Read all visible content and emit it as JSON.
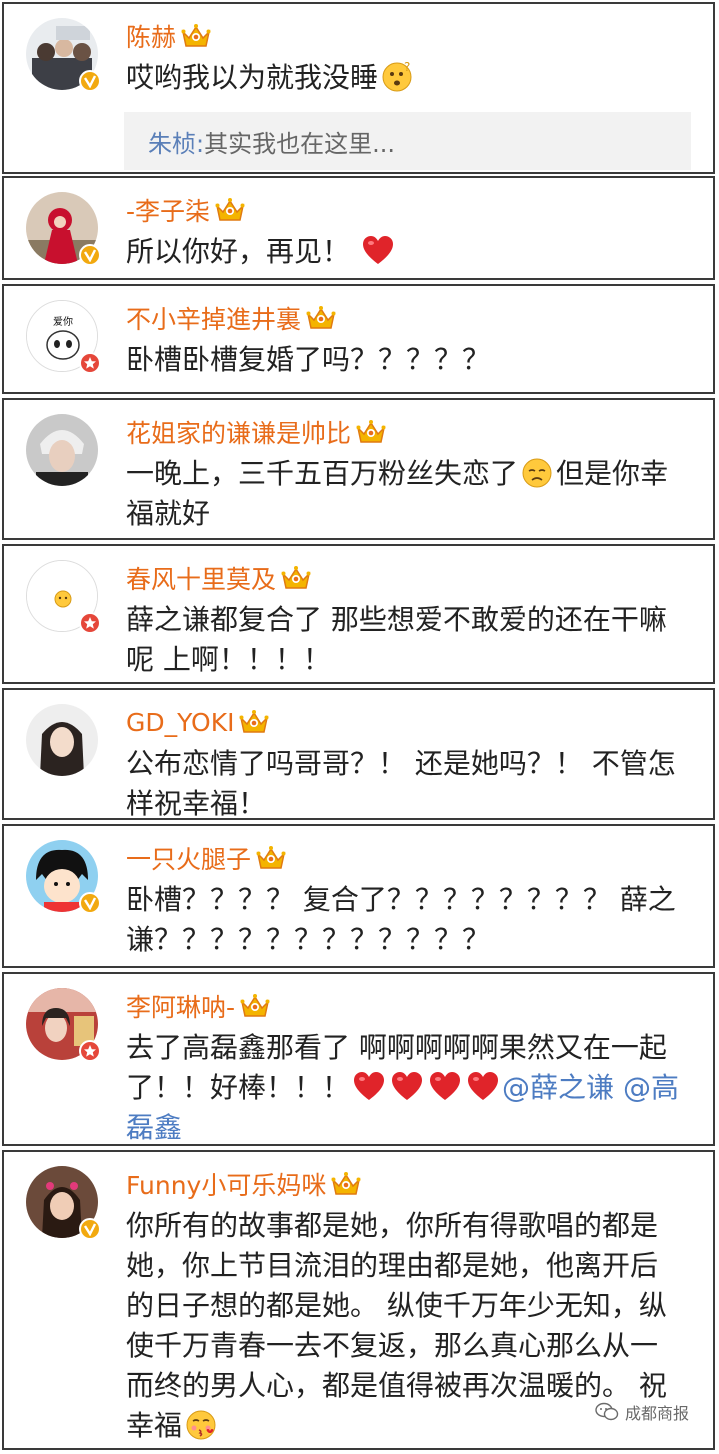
{
  "colors": {
    "username": "#e86c1a",
    "text": "#222222",
    "mention": "#4d7cc2",
    "reply_name": "#5a7fb8",
    "verified_gold": "#f2a90f",
    "verified_red": "#e5473a"
  },
  "comments": [
    {
      "user": "陈赫",
      "text": "哎哟我以为就我没睡",
      "emoji": "thinking-face",
      "badge": "gold",
      "reply": {
        "name": "朱桢:",
        "text": " 其实我也在这里..."
      }
    },
    {
      "user": "-李子柒",
      "text": "所以你好，再见！",
      "emoji": "red-heart",
      "badge": "gold"
    },
    {
      "user": "不小辛掉進井裏",
      "text": "卧槽卧槽复婚了吗？？？？？",
      "badge": "red",
      "avatar_text": "爱你"
    },
    {
      "user": "花姐家的谦谦是帅比",
      "text_a": "一晚上，三千五百万粉丝失恋了",
      "text_b": "但是你幸福就好",
      "emoji": "sad-face"
    },
    {
      "user": "春风十里莫及",
      "text": "薛之谦都复合了 那些想爱不敢爱的还在干嘛呢 上啊！！！！",
      "badge": "red"
    },
    {
      "user": "GD_YOKI",
      "text": "公布恋情了吗哥哥？！ 还是她吗？！ 不管怎样祝幸福！"
    },
    {
      "user": "一只火腿子",
      "text": "卧槽？？？？ 复合了？？？？？？？？ 薛之谦？？？？？？？？？？？？",
      "badge": "gold"
    },
    {
      "user": "李阿琳呐-",
      "text_a": "去了高磊鑫那看了 啊啊啊啊啊果然又在一起了！！好棒！！！",
      "mention_a": "@薛之谦",
      "mention_b": "@高磊鑫",
      "badge": "red"
    },
    {
      "user": "Funny小可乐妈咪",
      "text": "你所有的故事都是她，你所有得歌唱的都是她，你上节目流泪的理由都是她，他离开后的日子想的都是她。 纵使千万年少无知，纵使千万青春一去不复返，那么真心那么从一而终的男人心，都是值得被再次温暖的。 祝幸福",
      "emoji": "kiss-face",
      "badge": "gold"
    }
  ],
  "watermark": {
    "text": "成都商报",
    "icon": "wechat-icon"
  }
}
